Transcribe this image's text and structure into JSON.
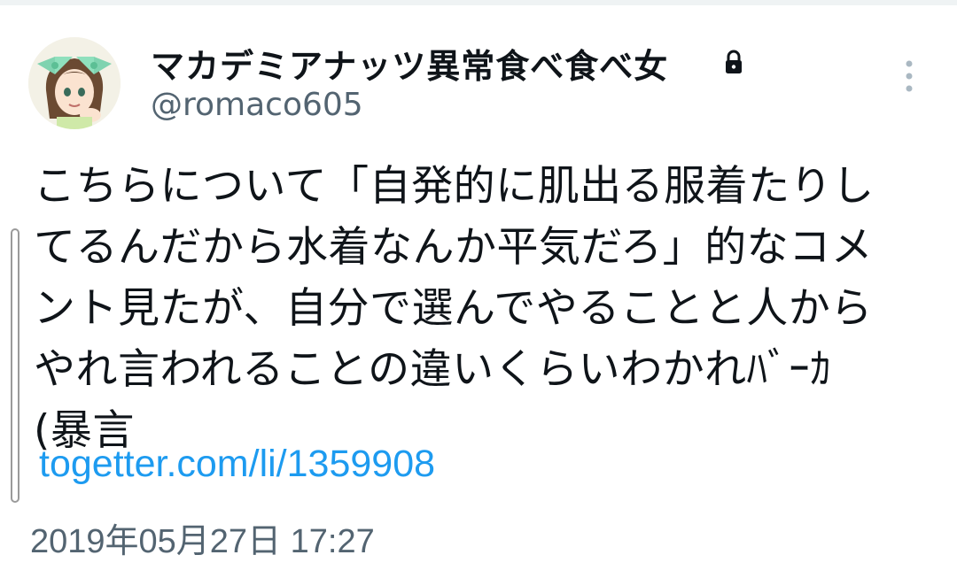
{
  "tweet": {
    "display_name": "マカデミアナッツ異常食べ食べ女",
    "handle": "@romaco605",
    "text_lines": [
      "こちらについて「自発的に肌出る服着たりし",
      "てるんだから水着なんか平気だろ」的なコメ",
      "ント見たが、自分で選んでやることと人から",
      "やれ言われることの違いくらいわかれﾊﾞｰｶ",
      "(暴言"
    ],
    "link": "togetter.com/li/1359908",
    "timestamp": "2019年05月27日 17:27"
  },
  "icons": {
    "lock": "lock-icon",
    "more": "more-vertical-icon",
    "avatar": "avatar-image"
  },
  "colors": {
    "link": "#1d9bf0",
    "secondary_text": "#536471",
    "primary_text": "#0f1419",
    "avatar_bow": "#7fd3b0"
  }
}
